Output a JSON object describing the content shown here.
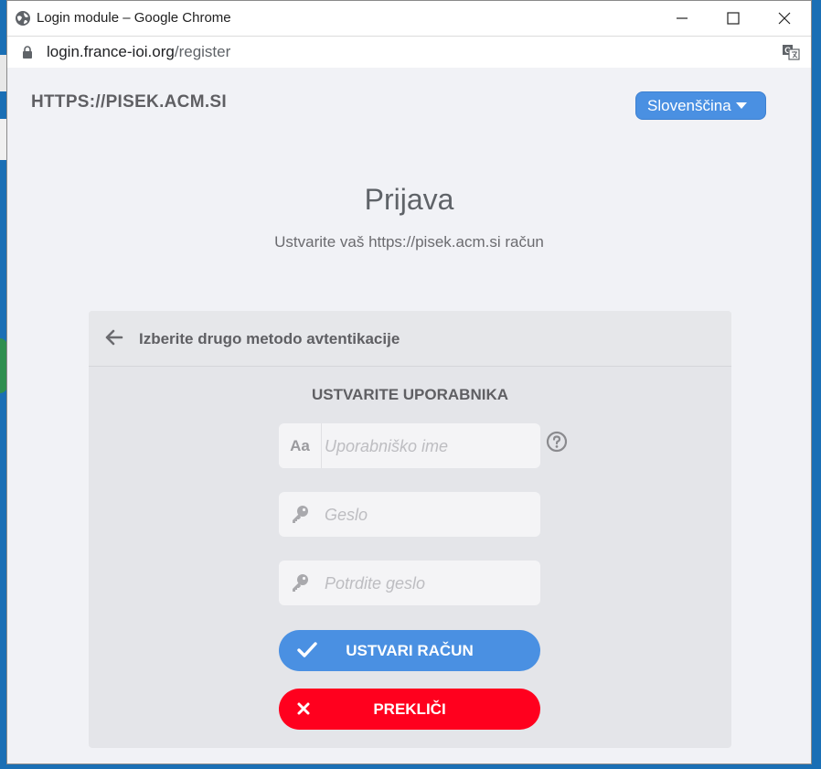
{
  "window": {
    "title": "Login module – Google Chrome",
    "url_host": "login.france-ioi.org",
    "url_path": "/register"
  },
  "header": {
    "site_name": "HTTPS://PISEK.ACM.SI",
    "language": "Slovenščina"
  },
  "hero": {
    "title": "Prijava",
    "subtitle": "Ustvarite vaš https://pisek.acm.si račun"
  },
  "panel": {
    "back_label": "Izberite drugo metodo avtentikacije",
    "form_title": "USTVARITE UPORABNIKA",
    "username_prefix": "Aa",
    "username_placeholder": "Uporabniško ime",
    "password_placeholder": "Geslo",
    "confirm_placeholder": "Potrdite geslo",
    "create_label": "USTVARI RAČUN",
    "cancel_label": "PREKLIČI"
  },
  "colors": {
    "accent": "#4a90e2",
    "danger": "#ff001e",
    "page_bg": "#f1f2f6",
    "panel_bg": "#e4e5e9"
  },
  "icons": [
    "globe-icon",
    "minimize-icon",
    "maximize-icon",
    "close-icon",
    "lock-icon",
    "translate-icon",
    "arrow-left-icon",
    "key-icon",
    "help-circle-icon",
    "check-icon",
    "x-icon"
  ]
}
